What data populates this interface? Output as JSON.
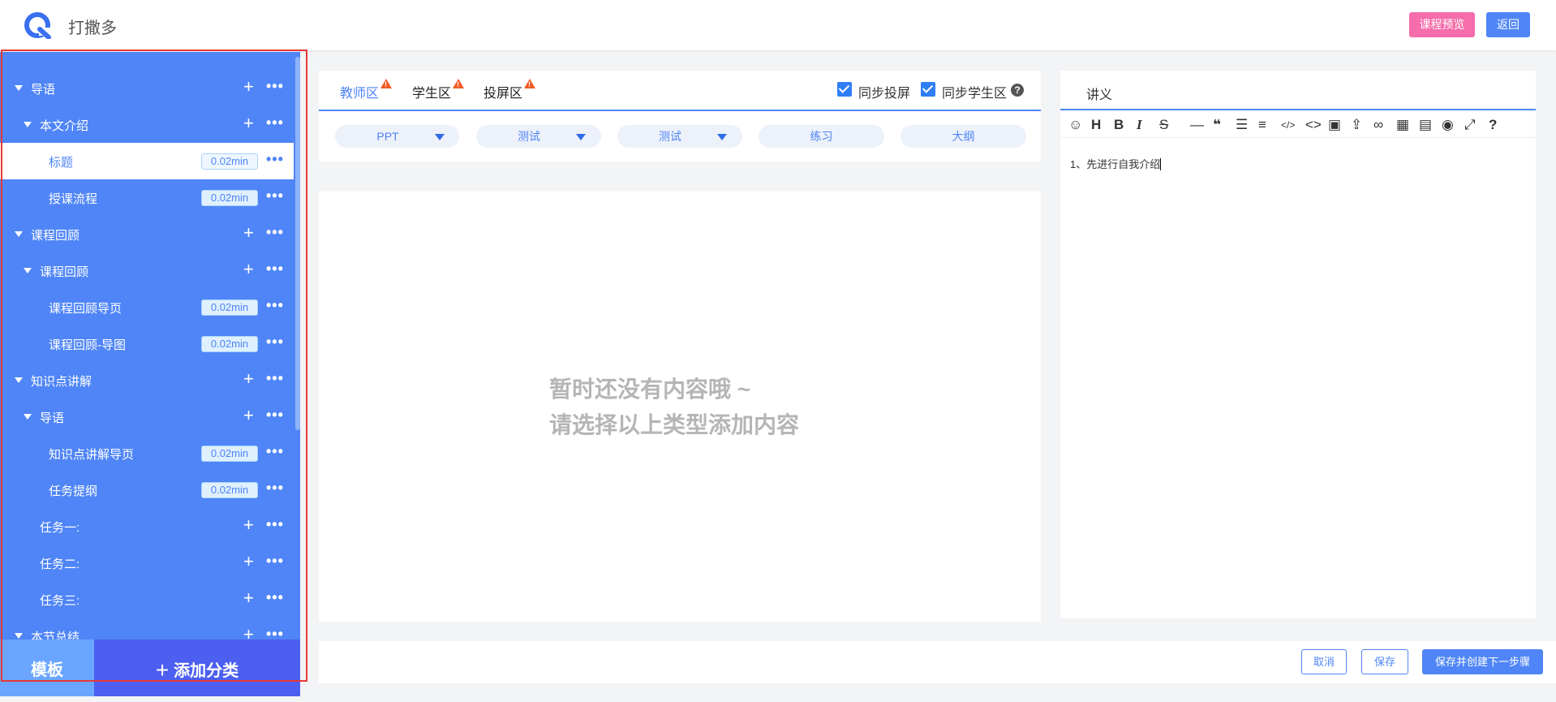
{
  "header": {
    "app_title": "打撒多",
    "preview_label": "课程预览",
    "back_label": "返回"
  },
  "sidebar": {
    "items": [
      {
        "label": "导语",
        "level": 0,
        "caret": true,
        "kind": "group"
      },
      {
        "label": "本文介绍",
        "level": 1,
        "caret": true,
        "kind": "group"
      },
      {
        "label": "标题",
        "level": 2,
        "caret": false,
        "kind": "page",
        "duration": "0.02min",
        "active": true
      },
      {
        "label": "授课流程",
        "level": 2,
        "caret": false,
        "kind": "page",
        "duration": "0.02min"
      },
      {
        "label": "课程回顾",
        "level": 0,
        "caret": true,
        "kind": "group"
      },
      {
        "label": "课程回顾",
        "level": 1,
        "caret": true,
        "kind": "group"
      },
      {
        "label": "课程回顾导页",
        "level": 2,
        "caret": false,
        "kind": "page",
        "duration": "0.02min"
      },
      {
        "label": "课程回顾-导图",
        "level": 2,
        "caret": false,
        "kind": "page",
        "duration": "0.02min"
      },
      {
        "label": "知识点讲解",
        "level": 0,
        "caret": true,
        "kind": "group"
      },
      {
        "label": "导语",
        "level": 1,
        "caret": true,
        "kind": "group"
      },
      {
        "label": "知识点讲解导页",
        "level": 2,
        "caret": false,
        "kind": "page",
        "duration": "0.02min"
      },
      {
        "label": "任务提纲",
        "level": 2,
        "caret": false,
        "kind": "page",
        "duration": "0.02min"
      },
      {
        "label": "任务一:",
        "level": 1,
        "caret": false,
        "kind": "group"
      },
      {
        "label": "任务二:",
        "level": 1,
        "caret": false,
        "kind": "group"
      },
      {
        "label": "任务三:",
        "level": 1,
        "caret": false,
        "kind": "group"
      },
      {
        "label": "本节总结",
        "level": 0,
        "caret": true,
        "kind": "group"
      }
    ],
    "template_tab": "模板",
    "add_category": "添加分类"
  },
  "zones": {
    "tabs": [
      {
        "label": "教师区",
        "active": true,
        "warning": true
      },
      {
        "label": "学生区",
        "active": false,
        "warning": true
      },
      {
        "label": "投屏区",
        "active": false,
        "warning": true
      }
    ],
    "sync_screen_label": "同步投屏",
    "sync_student_label": "同步学生区",
    "sync_screen_checked": true,
    "sync_student_checked": true,
    "help_glyph": "?"
  },
  "content_types": [
    {
      "label": "PPT",
      "dropdown": true
    },
    {
      "label": "测试",
      "dropdown": true
    },
    {
      "label": "测试",
      "dropdown": true
    },
    {
      "label": "练习",
      "dropdown": false
    },
    {
      "label": "大纲",
      "dropdown": false
    }
  ],
  "empty_state": {
    "line1": "暂时还没有内容哦 ~",
    "line2": "请选择以上类型添加内容"
  },
  "notes": {
    "title": "讲义",
    "content": "1、先进行自我介绍",
    "toolbar": [
      "emoji-icon",
      "heading-icon",
      "bold-icon",
      "italic-icon",
      "strikethrough-icon",
      "hr-icon",
      "quote-icon",
      "bullet-list-icon",
      "ordered-list-icon",
      "inline-code-icon",
      "code-block-icon",
      "image-icon",
      "upload-icon",
      "link-icon",
      "table-icon",
      "toc-icon",
      "preview-icon",
      "fullscreen-icon",
      "help-icon"
    ]
  },
  "footer": {
    "cancel_label": "取消",
    "save_label": "保存",
    "save_next_label": "保存并创建下一步骤"
  },
  "colors": {
    "primary": "#4f85f6",
    "preview_pink": "#f56dab",
    "add_category_bg": "#4c5ff0",
    "template_bg": "#6aa6ff",
    "warning": "#f05a24"
  }
}
